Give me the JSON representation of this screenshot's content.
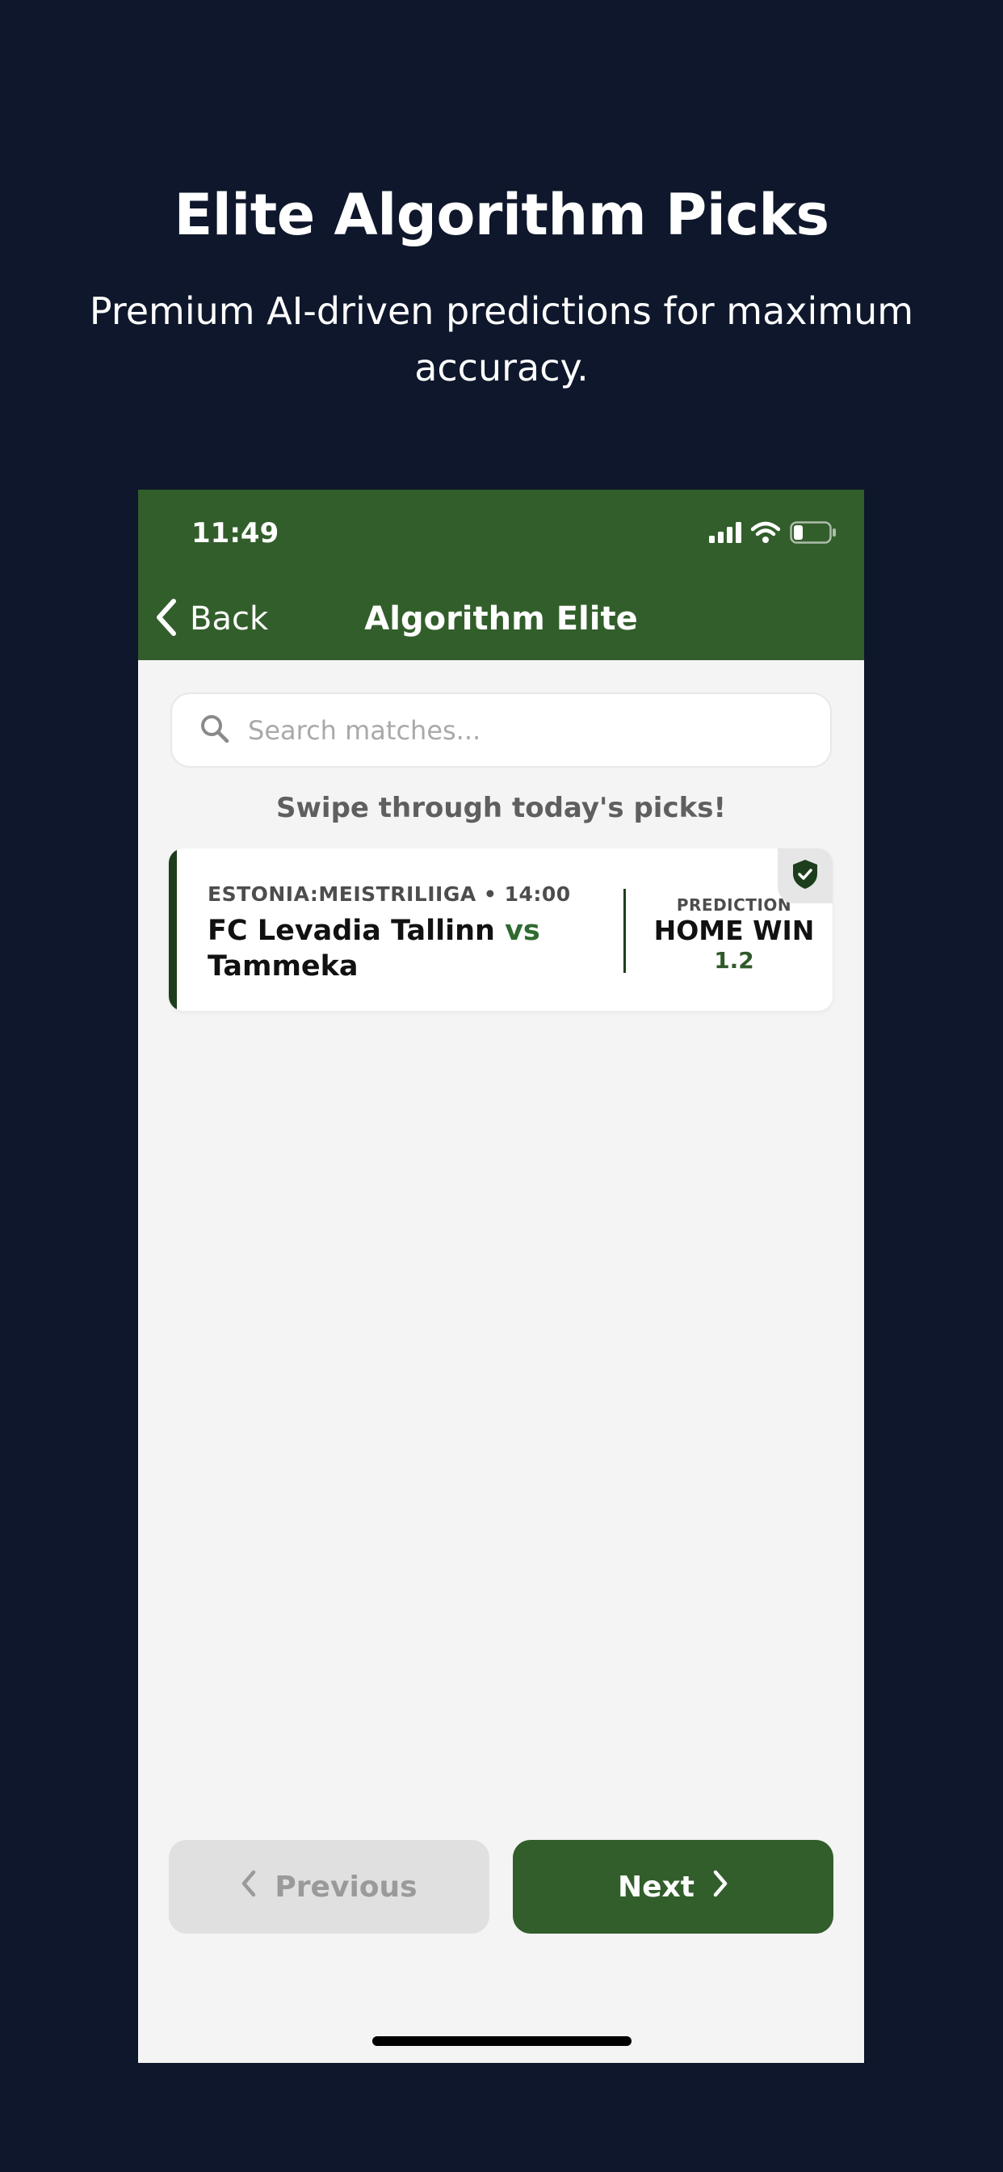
{
  "hero": {
    "title": "Elite Algorithm Picks",
    "subtitle": "Premium AI-driven predictions for maximum accuracy."
  },
  "status_bar": {
    "time": "11:49",
    "icons": [
      "signal-icon",
      "wifi-icon",
      "battery-icon"
    ]
  },
  "nav": {
    "back_label": "Back",
    "title": "Algorithm Elite"
  },
  "search": {
    "placeholder": "Search matches...",
    "value": ""
  },
  "hint": "Swipe through today's picks!",
  "pick": {
    "league_time": "ESTONIA:MEISTRILIIGA • 14:00",
    "home_team": "FC Levadia Tallinn",
    "vs": "vs",
    "away_team": "Tammeka",
    "prediction_label": "PREDICTION",
    "prediction": "HOME WIN",
    "odds": "1.2",
    "badge_icon": "shield-check-icon"
  },
  "pager": {
    "previous_label": "Previous",
    "next_label": "Next"
  },
  "colors": {
    "page_background": "#0e172b",
    "header_green": "#325e2b",
    "accent_dark_green": "#1d3e1d",
    "app_background": "#f4f4f4"
  }
}
